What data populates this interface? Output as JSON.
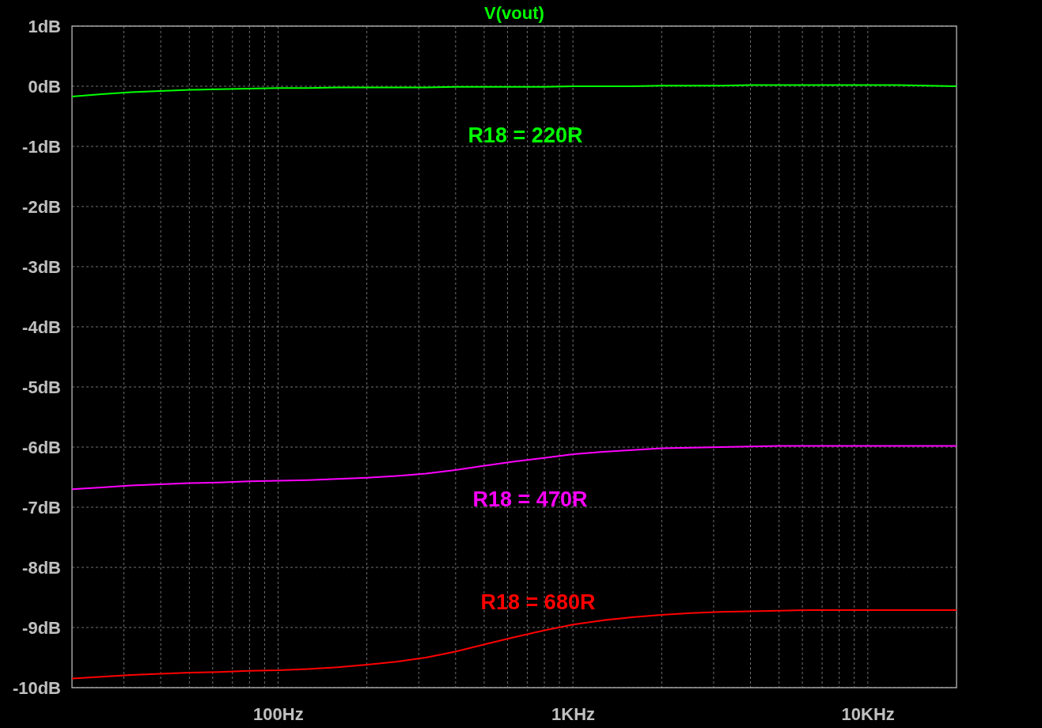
{
  "chart_data": {
    "type": "line",
    "title": "V(vout)",
    "grid": true,
    "categories": [
      null,
      null,
      null,
      null,
      null,
      null,
      null,
      "100Hz",
      null,
      null,
      null,
      null,
      null,
      null,
      null,
      null,
      null,
      "1KHz",
      null,
      null,
      null,
      null,
      null,
      null,
      null,
      null,
      null,
      "10KHz",
      null,
      null,
      null
    ],
    "series": [
      {
        "name": "R18 = 220R",
        "color": "#00ff00",
        "values": [
          -0.17,
          -0.13,
          -0.1,
          -0.08,
          -0.06,
          -0.05,
          -0.04,
          -0.03,
          -0.03,
          -0.02,
          -0.02,
          -0.02,
          -0.02,
          -0.01,
          -0.01,
          -0.01,
          -0.01,
          0,
          0,
          0,
          0.01,
          0.01,
          0.01,
          0.02,
          0.02,
          0.02,
          0.02,
          0.02,
          0.02,
          0.01,
          0
        ]
      },
      {
        "name": "R18 = 470R",
        "color": "#ff00ff",
        "values": [
          -6.7,
          -6.67,
          -6.64,
          -6.62,
          -6.6,
          -6.59,
          -6.57,
          -6.56,
          -6.55,
          -6.53,
          -6.51,
          -6.48,
          -6.44,
          -6.38,
          -6.31,
          -6.24,
          -6.18,
          -6.12,
          -6.08,
          -6.05,
          -6.02,
          -6.01,
          -6.0,
          -5.99,
          -5.98,
          -5.98,
          -5.98,
          -5.98,
          -5.98,
          -5.98,
          -5.98
        ]
      },
      {
        "name": "R18 = 680R",
        "color": "#ff0000",
        "values": [
          -9.85,
          -9.82,
          -9.79,
          -9.77,
          -9.75,
          -9.74,
          -9.72,
          -9.71,
          -9.69,
          -9.66,
          -9.62,
          -9.57,
          -9.5,
          -9.4,
          -9.28,
          -9.16,
          -9.05,
          -8.95,
          -8.88,
          -8.83,
          -8.79,
          -8.76,
          -8.74,
          -8.73,
          -8.72,
          -8.71,
          -8.71,
          -8.71,
          -8.71,
          -8.71,
          -8.71
        ]
      }
    ],
    "ylim": [
      -10,
      1
    ],
    "yticks": [
      {
        "value": 1,
        "label": "1dB"
      },
      {
        "value": 0,
        "label": "0dB"
      },
      {
        "value": -1,
        "label": "-1dB"
      },
      {
        "value": -2,
        "label": "-2dB"
      },
      {
        "value": -3,
        "label": "-3dB"
      },
      {
        "value": -4,
        "label": "-4dB"
      },
      {
        "value": -5,
        "label": "-5dB"
      },
      {
        "value": -6,
        "label": "-6dB"
      },
      {
        "value": -7,
        "label": "-7dB"
      },
      {
        "value": -8,
        "label": "-8dB"
      },
      {
        "value": -9,
        "label": "-9dB"
      },
      {
        "value": -10,
        "label": "-10dB"
      }
    ]
  }
}
